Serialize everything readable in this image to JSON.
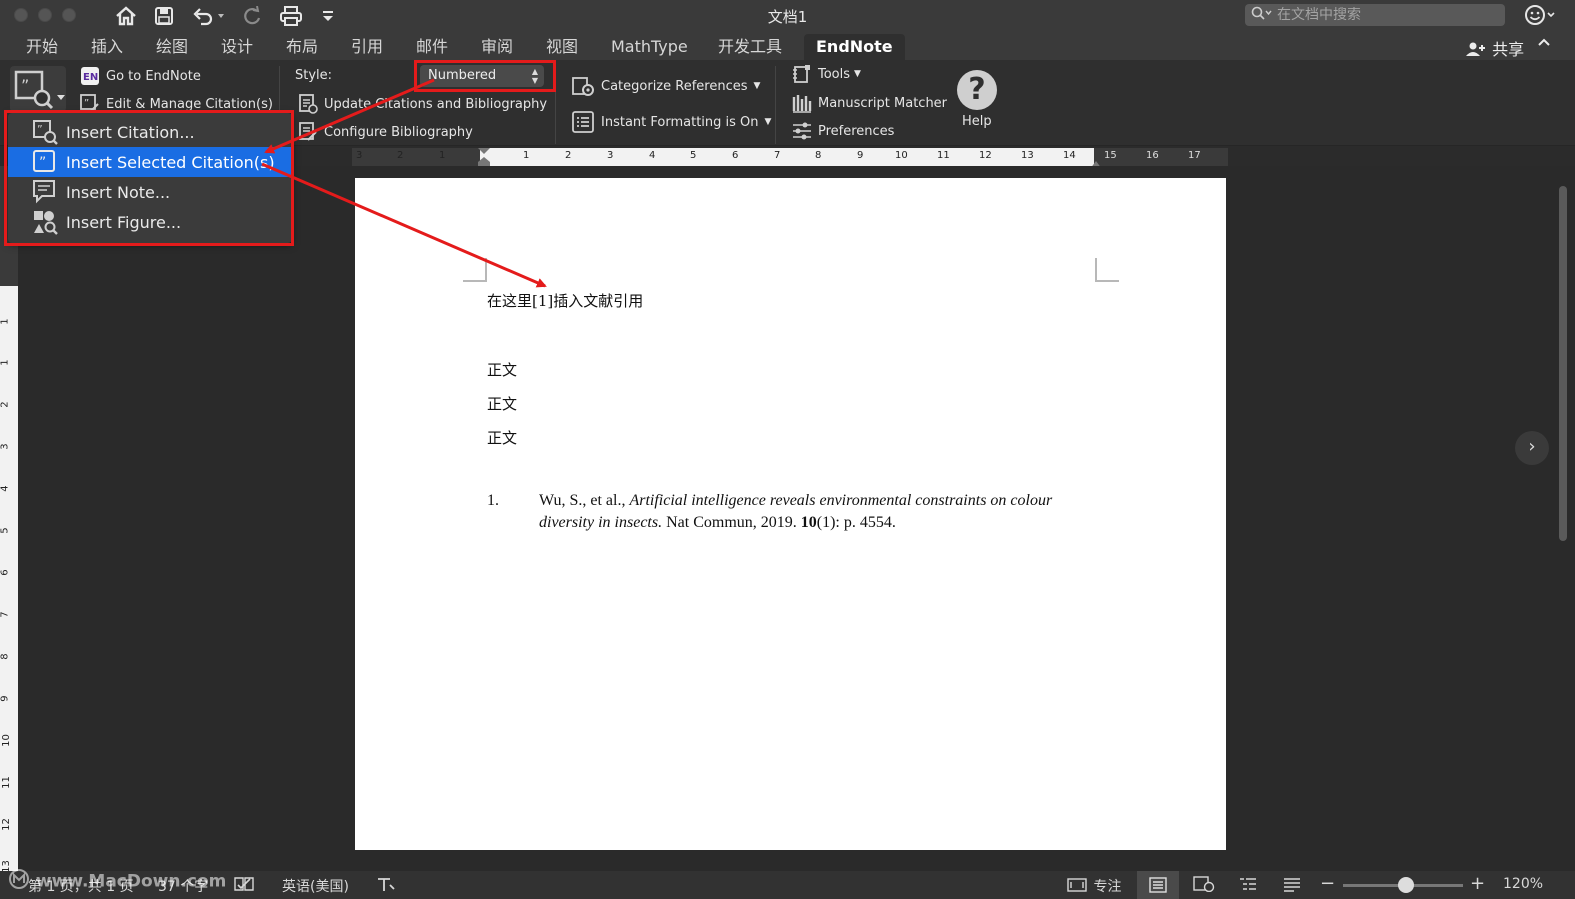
{
  "window": {
    "title": "文档1"
  },
  "quick_access": {
    "icons": [
      "home-icon",
      "save-icon",
      "undo-icon",
      "redo-icon",
      "print-icon",
      "customize-icon"
    ]
  },
  "search": {
    "placeholder": "在文档中搜索"
  },
  "tabs": [
    {
      "label": "开始"
    },
    {
      "label": "插入"
    },
    {
      "label": "绘图"
    },
    {
      "label": "设计"
    },
    {
      "label": "布局"
    },
    {
      "label": "引用"
    },
    {
      "label": "邮件"
    },
    {
      "label": "审阅"
    },
    {
      "label": "视图"
    },
    {
      "label": "MathType"
    },
    {
      "label": "开发工具"
    },
    {
      "label": "EndNote"
    }
  ],
  "share_label": "共享",
  "ribbon": {
    "go_to_endnote": "Go to EndNote",
    "edit_manage": "Edit & Manage Citation(s)",
    "style_label": "Style:",
    "style_value": "Numbered",
    "update_citations": "Update Citations and Bibliography",
    "configure_bibliography": "Configure Bibliography",
    "categorize_references": "Categorize References",
    "instant_formatting": "Instant Formatting is On",
    "tools": "Tools",
    "manuscript_matcher": "Manuscript Matcher",
    "preferences": "Preferences",
    "help": "Help"
  },
  "insert_menu": {
    "items": [
      {
        "label": "Insert Citation..."
      },
      {
        "label": "Insert Selected Citation(s)"
      },
      {
        "label": "Insert Note..."
      },
      {
        "label": "Insert Figure..."
      }
    ],
    "selected_index": 1
  },
  "ruler": {
    "h_ticks": [
      "3",
      "2",
      "1",
      "1",
      "2",
      "3",
      "4",
      "5",
      "6",
      "7",
      "8",
      "9",
      "10",
      "11",
      "12",
      "13",
      "14",
      "15",
      "16",
      "17"
    ],
    "v_ticks": [
      "1",
      "1",
      "2",
      "3",
      "4",
      "5",
      "6",
      "7",
      "8",
      "9",
      "10",
      "11",
      "12",
      "13"
    ]
  },
  "document": {
    "line1": "在这里[1]插入文献引用",
    "body": [
      "正文",
      "正文",
      "正文"
    ],
    "reference": {
      "number": "1.",
      "authors": "Wu, S., et al., ",
      "title_part1": "Artificial intelligence reveals environmental constraints on colour",
      "title_part2": "diversity in insects.",
      "journal": " Nat Commun, 2019. ",
      "volume": "10",
      "rest": "(1): p. 4554."
    }
  },
  "statusbar": {
    "page": "第 1 页，共 1 页",
    "words": "37 个字",
    "language": "英语(美国)",
    "focus": "专注",
    "zoom": "120%"
  },
  "watermark": "www.MacDown.com",
  "colors": {
    "accent": "#1a6de3",
    "highlight_red": "#e41b1b",
    "ribbon_bg": "#2f2f2f"
  }
}
